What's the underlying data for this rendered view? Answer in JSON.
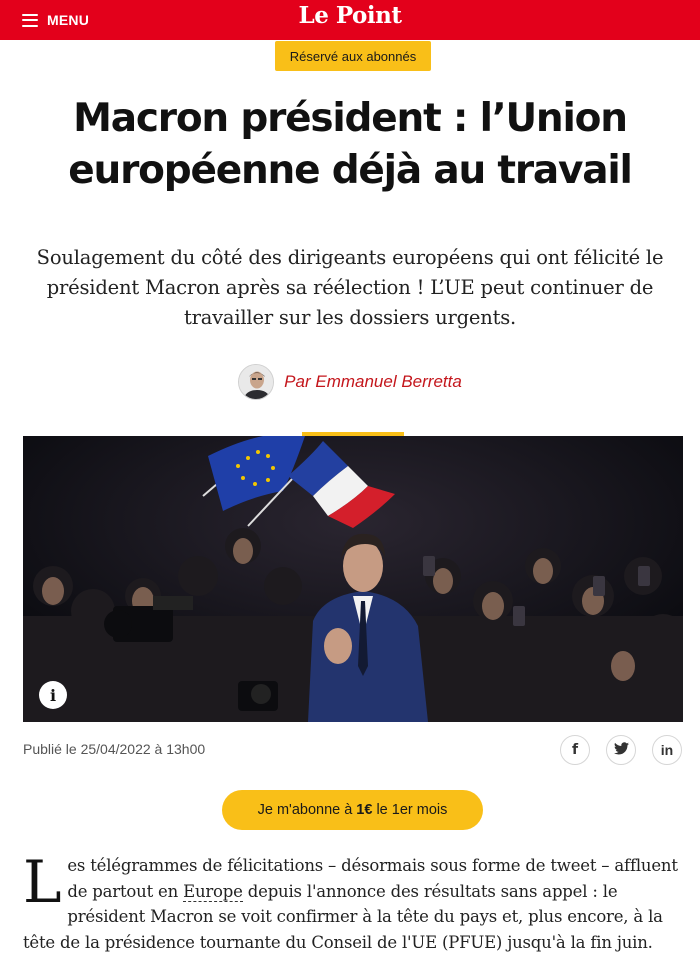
{
  "header": {
    "menu_label": "MENU",
    "logo": "Le Point",
    "brand_color": "#e3001b"
  },
  "badge": "Réservé aux abonnés",
  "article": {
    "title": "Macron président : l’Union européenne déjà au travail",
    "lede": "Soulagement du côté des dirigeants européens qui ont félicité le président Macron après sa réélection ! L’UE peut continuer de travailler sur les dossiers urgents.",
    "author": "Par Emmanuel Berretta",
    "published": "Publié le 25/04/2022 à 13h00",
    "body_dropcap": "L",
    "body_1": "es télégrammes de félicitations – désormais sous forme de tweet – affluent de partout en ",
    "body_link": "Europe",
    "body_2": " depuis l'annonce des résultats sans appel : le président Macron se voit confirmer à la tête du pays et, plus encore, à la tête de la présidence tournante du Conseil de l'UE (PFUE) jusqu'à la fin juin. Xavier Bettel, le"
  },
  "photo": {
    "info_glyph": "i"
  },
  "share": [
    {
      "name": "facebook-icon",
      "glyph": "f"
    },
    {
      "name": "twitter-icon",
      "glyph": "🐦"
    },
    {
      "name": "linkedin-icon",
      "glyph": "in"
    }
  ],
  "cta": {
    "before": "Je m'abonne à",
    "price": "1€",
    "after": "le 1er mois"
  },
  "accent_color": "#f9bf18"
}
